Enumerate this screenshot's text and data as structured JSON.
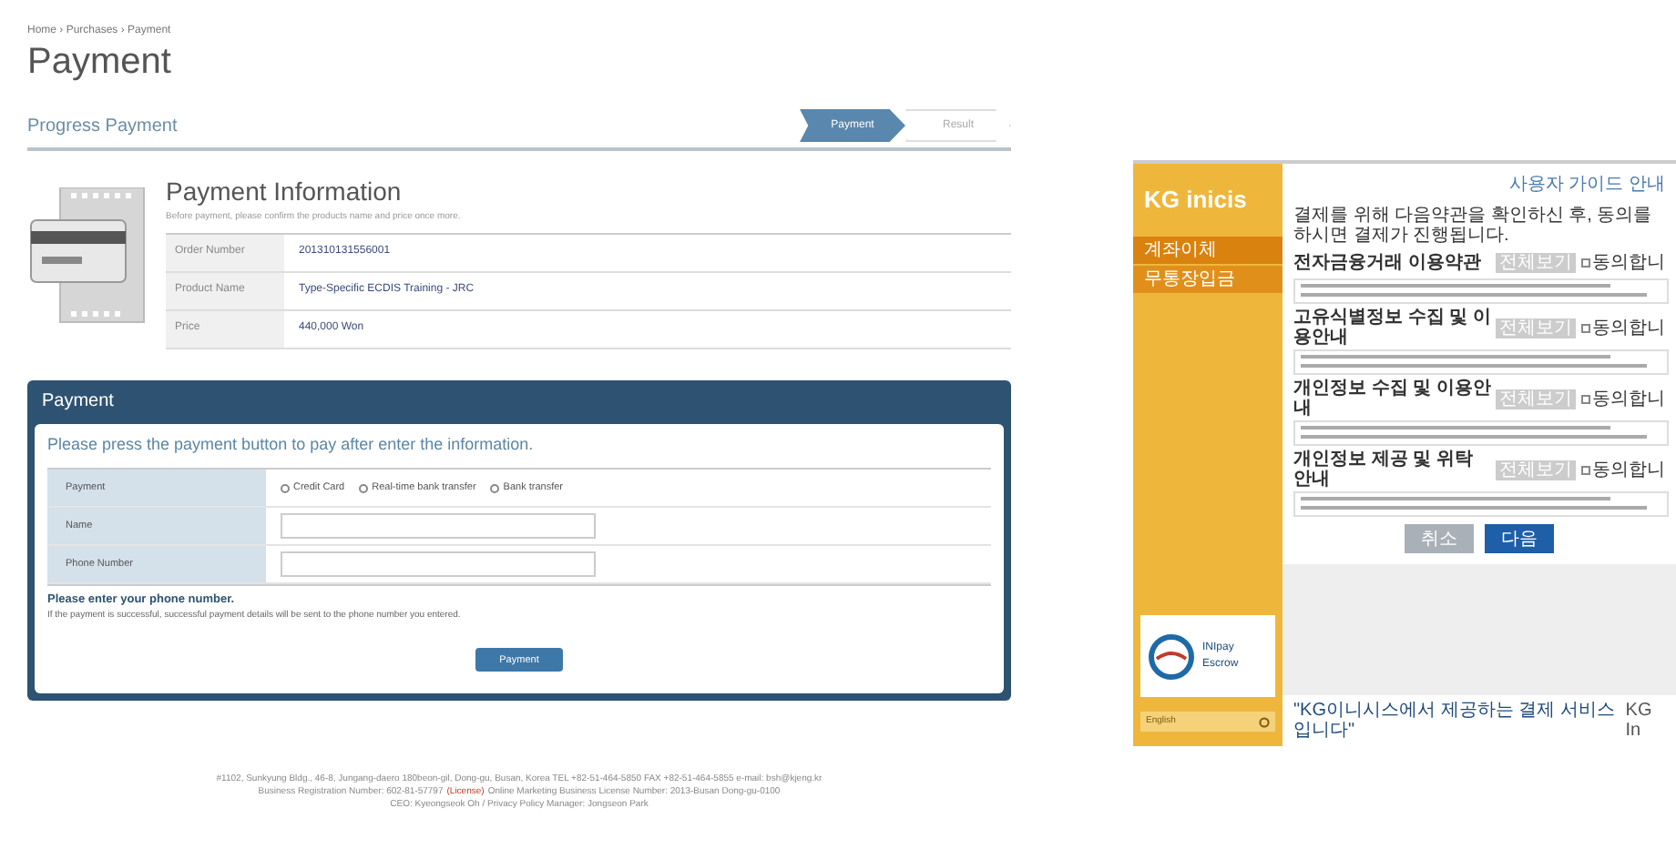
{
  "breadcrumb": "Home › Purchases › Payment",
  "title": "Payment",
  "progress": {
    "title": "Progress Payment",
    "steps": [
      {
        "label": "Payment",
        "selected": true
      },
      {
        "label": "Result",
        "selected": false
      }
    ]
  },
  "info": {
    "title": "Payment Information",
    "subtitle": "Before payment, please confirm the products name and price once more.",
    "rows": [
      {
        "label": "Order Number",
        "value": "201310131556001"
      },
      {
        "label": "Product Name",
        "value": "Type-Specific ECDIS Training - JRC"
      },
      {
        "label": "Price",
        "value": "440,000 Won"
      }
    ]
  },
  "payment_panel": {
    "title": "Payment",
    "instruction": "Please press the payment button to pay after enter the information.",
    "method_label": "Payment",
    "methods": [
      {
        "label": "Credit Card",
        "selected": false
      },
      {
        "label": "Real-time bank transfer",
        "selected": false
      },
      {
        "label": "Bank transfer",
        "selected": false
      }
    ],
    "fields": [
      {
        "label": "Name"
      },
      {
        "label": "Phone Number"
      }
    ],
    "note_title": "Please enter your phone number.",
    "note": "If the payment is successful, successful payment details will be sent to the phone number you entered.",
    "button": "Payment"
  },
  "footer": [
    "#1102, Sunkyung Bldg., 46-8, Jungang-daero 180beon-gil, Dong-gu, Busan, Korea TEL +82-51-464-5850 FAX +82-51-464-5855 e-mail: bsh@kjeng.kr",
    "Business Registration Number: 602-81-57797",
    "(License)",
    "Online Marketing Business License Number: 2013-Busan Dong-gu-0100",
    "CEO: Kyeongseok Oh / Privacy Policy Manager: Jongseon Park"
  ],
  "popup": {
    "logo": "KG inicis",
    "menu": [
      {
        "label": "계좌이체",
        "selected": true
      },
      {
        "label": "무통장입금",
        "selected": false
      }
    ],
    "badge": [
      "INIpay",
      "Escrow"
    ],
    "language": "English",
    "top_link": "사용자 가이드 안내",
    "intro": "결제를 위해 다음약관을 확인하신 후, 동의를 하시면 결제가 진행됩니다.",
    "terms": [
      {
        "title": "전자금융거래 이용약관",
        "view": "전체보기",
        "agree": "동의합니",
        "checked": false
      },
      {
        "title": "고유식별정보 수집 및 이용안내",
        "view": "전체보기",
        "agree": "동의합니",
        "checked": false
      },
      {
        "title": "개인정보 수집 및 이용안내",
        "view": "전체보기",
        "agree": "동의합니",
        "checked": false
      },
      {
        "title": "개인정보 제공 및 위탁 안내",
        "view": "전체보기",
        "agree": "동의합니",
        "checked": false
      }
    ],
    "cancel": "취소",
    "next": "다음",
    "bottom_text": "\"KG이니시스에서 제공하는 결제 서비스입니다\"",
    "bottom_brand": "KG In"
  }
}
